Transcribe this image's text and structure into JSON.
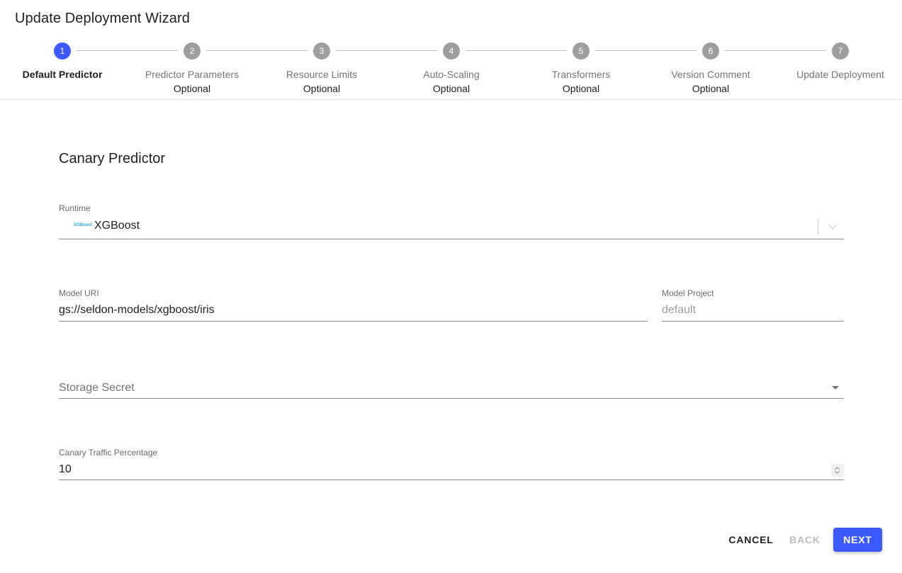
{
  "header": {
    "title": "Update Deployment Wizard"
  },
  "stepper": {
    "active_step": 1,
    "accent_color": "#3d5afe",
    "inactive_color": "#9e9e9e",
    "steps": [
      {
        "number": "1",
        "label": "Default Predictor",
        "optional": ""
      },
      {
        "number": "2",
        "label": "Predictor Parameters",
        "optional": "Optional"
      },
      {
        "number": "3",
        "label": "Resource Limits",
        "optional": "Optional"
      },
      {
        "number": "4",
        "label": "Auto-Scaling",
        "optional": "Optional"
      },
      {
        "number": "5",
        "label": "Transformers",
        "optional": "Optional"
      },
      {
        "number": "6",
        "label": "Version Comment",
        "optional": "Optional"
      },
      {
        "number": "7",
        "label": "Update Deployment",
        "optional": ""
      }
    ]
  },
  "form": {
    "section_title": "Canary Predictor",
    "runtime": {
      "label": "Runtime",
      "value": "XGBoost",
      "logo_text": "XGBoost",
      "icon": "xgboost-logo"
    },
    "model_uri": {
      "label": "Model URI",
      "value": "gs://seldon-models/xgboost/iris"
    },
    "model_project": {
      "label": "Model Project",
      "placeholder": "default"
    },
    "storage_secret": {
      "placeholder": "Storage Secret"
    },
    "canary_traffic": {
      "label": "Canary Traffic Percentage",
      "value": "10"
    }
  },
  "actions": {
    "cancel_label": "CANCEL",
    "back_label": "BACK",
    "next_label": "NEXT"
  }
}
